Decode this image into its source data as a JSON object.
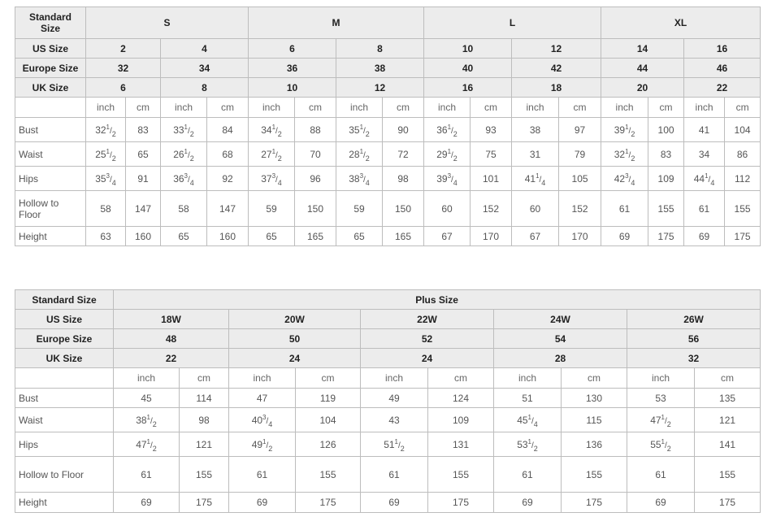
{
  "standard_table": {
    "header_label": "Standard\nSize",
    "groups": [
      {
        "name": "S",
        "sizes": [
          {
            "us": "2",
            "eu": "32",
            "uk": "6"
          },
          {
            "us": "4",
            "eu": "34",
            "uk": "8"
          }
        ]
      },
      {
        "name": "M",
        "sizes": [
          {
            "us": "6",
            "eu": "36",
            "uk": "10"
          },
          {
            "us": "8",
            "eu": "38",
            "uk": "12"
          }
        ]
      },
      {
        "name": "L",
        "sizes": [
          {
            "us": "10",
            "eu": "40",
            "uk": "16"
          },
          {
            "us": "12",
            "eu": "42",
            "uk": "18"
          }
        ]
      },
      {
        "name": "XL",
        "sizes": [
          {
            "us": "14",
            "eu": "44",
            "uk": "20"
          },
          {
            "us": "16",
            "eu": "46",
            "uk": "22"
          }
        ]
      }
    ],
    "row_labels": {
      "us": "US Size",
      "eu": "Europe Size",
      "uk": "UK Size"
    },
    "units": [
      "inch",
      "cm"
    ],
    "measurements": [
      {
        "label": "Bust",
        "values": [
          "32 1/2",
          "83",
          "33 1/2",
          "84",
          "34 1/2",
          "88",
          "35 1/2",
          "90",
          "36 1/2",
          "93",
          "38",
          "97",
          "39 1/2",
          "100",
          "41",
          "104"
        ]
      },
      {
        "label": "Waist",
        "values": [
          "25 1/2",
          "65",
          "26 1/2",
          "68",
          "27 1/2",
          "70",
          "28 1/2",
          "72",
          "29 1/2",
          "75",
          "31",
          "79",
          "32 1/2",
          "83",
          "34",
          "86"
        ]
      },
      {
        "label": "Hips",
        "values": [
          "35 3/4",
          "91",
          "36 3/4",
          "92",
          "37 3/4",
          "96",
          "38 3/4",
          "98",
          "39 3/4",
          "101",
          "41 1/4",
          "105",
          "42 3/4",
          "109",
          "44 1/4",
          "112"
        ]
      },
      {
        "label": "Hollow to Floor",
        "values": [
          "58",
          "147",
          "58",
          "147",
          "59",
          "150",
          "59",
          "150",
          "60",
          "152",
          "60",
          "152",
          "61",
          "155",
          "61",
          "155"
        ]
      },
      {
        "label": "Height",
        "values": [
          "63",
          "160",
          "65",
          "160",
          "65",
          "165",
          "65",
          "165",
          "67",
          "170",
          "67",
          "170",
          "69",
          "175",
          "69",
          "175"
        ]
      }
    ]
  },
  "plus_table": {
    "header_label": "Standard Size",
    "group_name": "Plus Size",
    "sizes": [
      {
        "us": "18W",
        "eu": "48",
        "uk": "22"
      },
      {
        "us": "20W",
        "eu": "50",
        "uk": "24"
      },
      {
        "us": "22W",
        "eu": "52",
        "uk": "24"
      },
      {
        "us": "24W",
        "eu": "54",
        "uk": "28"
      },
      {
        "us": "26W",
        "eu": "56",
        "uk": "32"
      }
    ],
    "row_labels": {
      "us": "US Size",
      "eu": "Europe Size",
      "uk": "UK Size"
    },
    "units": [
      "inch",
      "cm"
    ],
    "measurements": [
      {
        "label": "Bust",
        "values": [
          "45",
          "114",
          "47",
          "119",
          "49",
          "124",
          "51",
          "130",
          "53",
          "135"
        ]
      },
      {
        "label": "Waist",
        "values": [
          "38 1/2",
          "98",
          "40 3/4",
          "104",
          "43",
          "109",
          "45 1/4",
          "115",
          "47 1/2",
          "121"
        ]
      },
      {
        "label": "Hips",
        "values": [
          "47 1/2",
          "121",
          "49 1/2",
          "126",
          "51 1/2",
          "131",
          "53 1/2",
          "136",
          "55 1/2",
          "141"
        ]
      },
      {
        "label": "Hollow to Floor",
        "values": [
          "61",
          "155",
          "61",
          "155",
          "61",
          "155",
          "61",
          "155",
          "61",
          "155"
        ]
      },
      {
        "label": "Height",
        "values": [
          "69",
          "175",
          "69",
          "175",
          "69",
          "175",
          "69",
          "175",
          "69",
          "175"
        ]
      }
    ]
  }
}
